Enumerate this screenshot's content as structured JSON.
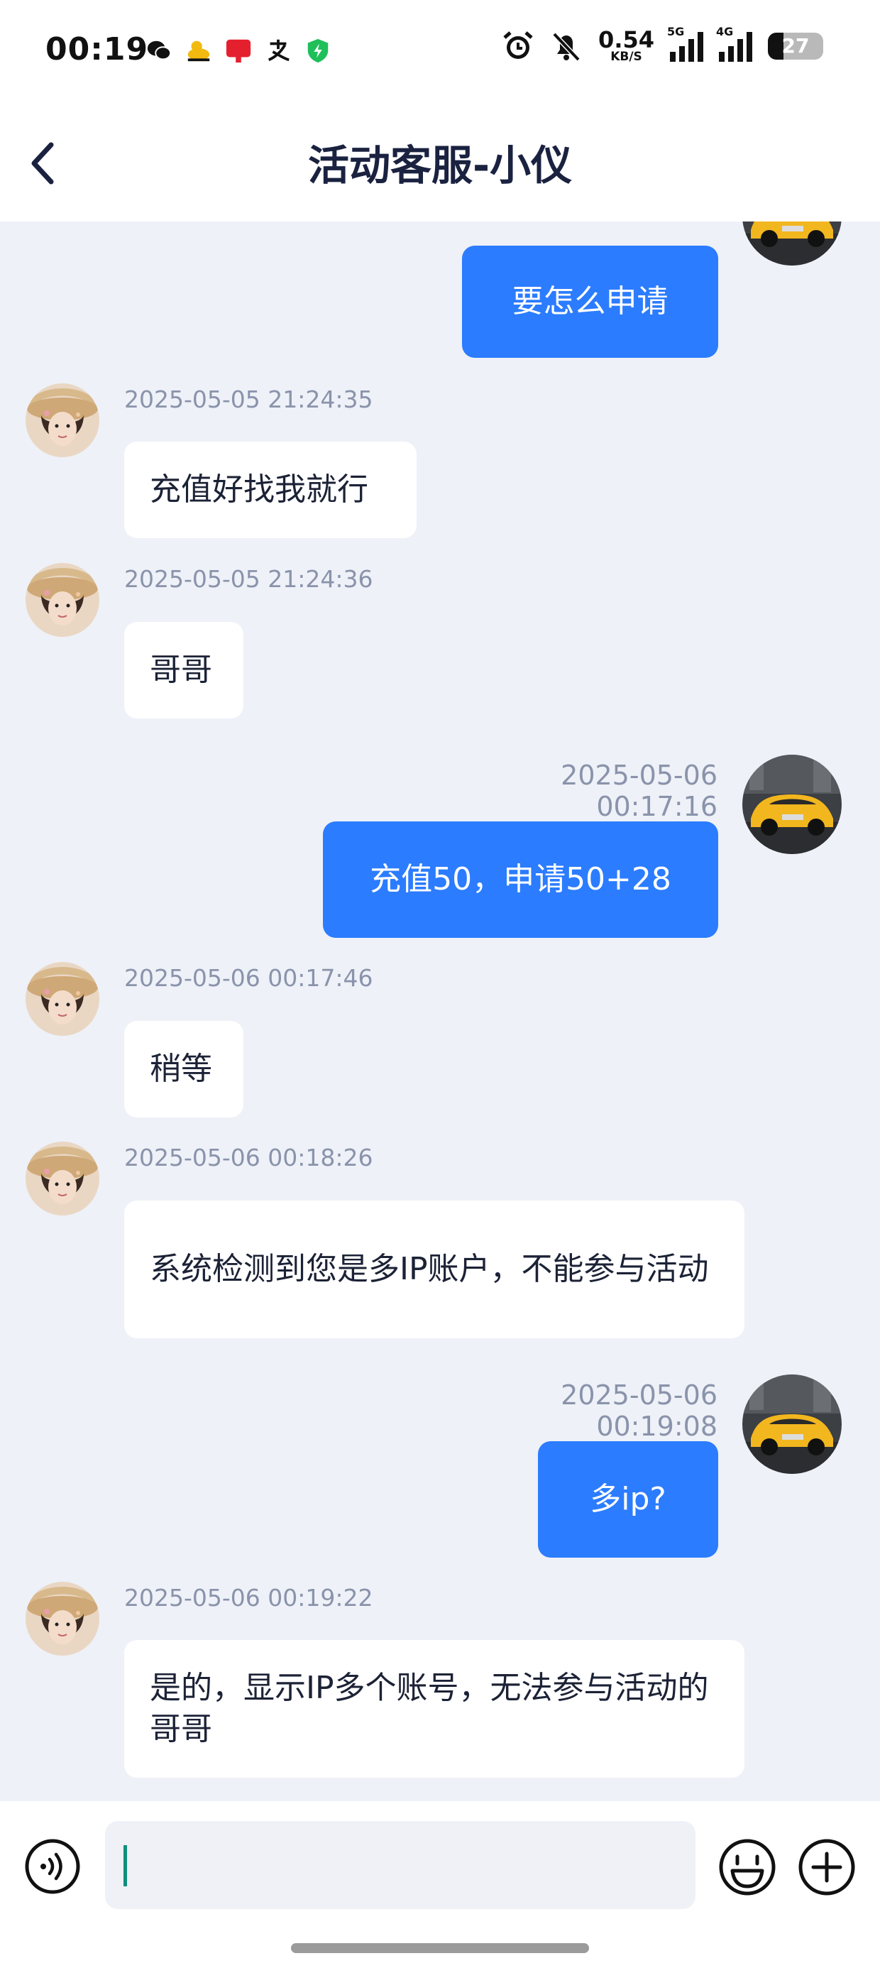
{
  "status_bar": {
    "time": "00:19",
    "net_speed": "0.54",
    "net_unit": "KB/S",
    "signal1_tag": "5G",
    "signal2_tag": "4G",
    "battery": "27"
  },
  "header": {
    "title": "活动客服-小仪"
  },
  "messages": [
    {
      "side": "right",
      "text": "要怎么申请"
    },
    {
      "side": "left",
      "time": "2025-05-05 21:24:35",
      "text": "充值好找我就行"
    },
    {
      "side": "left",
      "time": "2025-05-05 21:24:36",
      "text": "哥哥"
    },
    {
      "side": "right",
      "time": "2025-05-06 00:17:16",
      "text": "充值50，申请50+28"
    },
    {
      "side": "left",
      "time": "2025-05-06 00:17:46",
      "text": "稍等"
    },
    {
      "side": "left",
      "time": "2025-05-06 00:18:26",
      "text": "系统检测到您是多IP账户，不能参与活动"
    },
    {
      "side": "right",
      "time": "2025-05-06 00:19:08",
      "text": "多ip?"
    },
    {
      "side": "left",
      "time": "2025-05-06 00:19:22",
      "text": "是的，显示IP多个账号，无法参与活动的哥哥"
    }
  ],
  "input": {
    "value": "",
    "placeholder": ""
  },
  "colors": {
    "accent": "#2b7cff",
    "chat_bg": "#eef1f7",
    "caret": "#0f8f7c"
  }
}
